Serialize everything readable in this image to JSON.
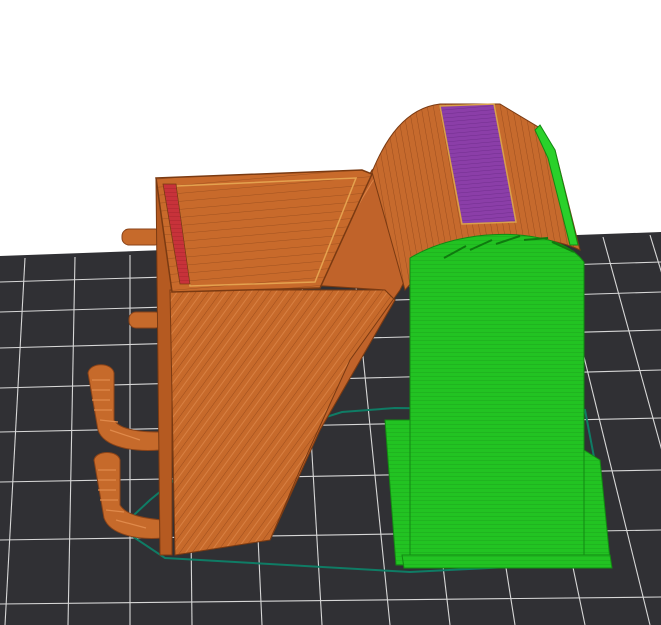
{
  "app": {
    "view": "slicer-gcode-preview",
    "background_color": "#ffffff",
    "bed_color": "#2f2f32",
    "grid_line_color": "#d9d9d9"
  },
  "preview": {
    "model": "printed-part-preview",
    "feature_colors": {
      "perimeter": "#c8692a",
      "infill": "#c3652a",
      "top_solid_infill": "#8a3da8",
      "solid_infill": "#c62f35",
      "support_material": "#22c322",
      "skirt": "#0b6f5a"
    },
    "icons": {
      "bed": "print-bed-icon",
      "part": "printed-part-icon",
      "support": "support-structure-icon"
    }
  }
}
